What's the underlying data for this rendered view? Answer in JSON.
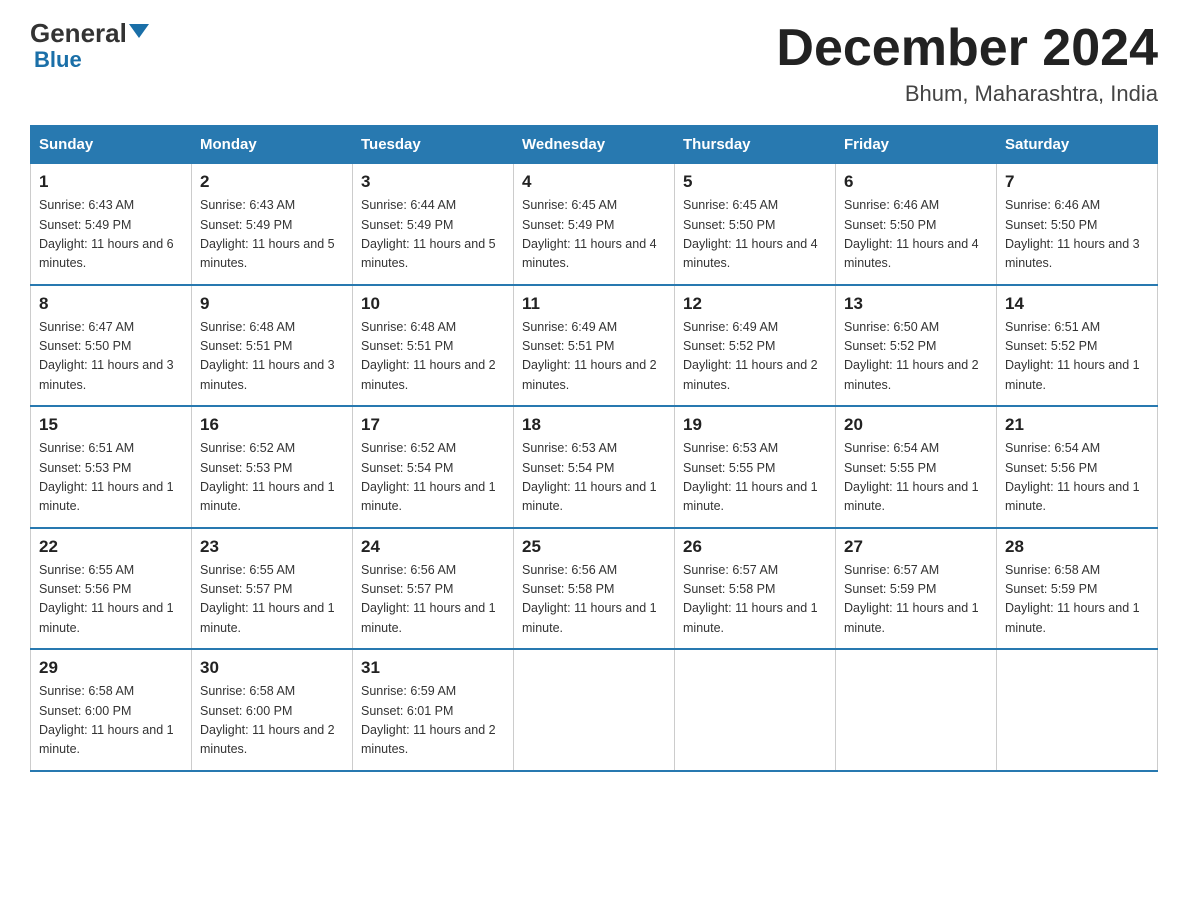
{
  "header": {
    "logo_general": "General",
    "logo_blue": "Blue",
    "month_title": "December 2024",
    "location": "Bhum, Maharashtra, India"
  },
  "weekdays": [
    "Sunday",
    "Monday",
    "Tuesday",
    "Wednesday",
    "Thursday",
    "Friday",
    "Saturday"
  ],
  "weeks": [
    [
      {
        "day": "1",
        "sunrise": "6:43 AM",
        "sunset": "5:49 PM",
        "daylight": "11 hours and 6 minutes."
      },
      {
        "day": "2",
        "sunrise": "6:43 AM",
        "sunset": "5:49 PM",
        "daylight": "11 hours and 5 minutes."
      },
      {
        "day": "3",
        "sunrise": "6:44 AM",
        "sunset": "5:49 PM",
        "daylight": "11 hours and 5 minutes."
      },
      {
        "day": "4",
        "sunrise": "6:45 AM",
        "sunset": "5:49 PM",
        "daylight": "11 hours and 4 minutes."
      },
      {
        "day": "5",
        "sunrise": "6:45 AM",
        "sunset": "5:50 PM",
        "daylight": "11 hours and 4 minutes."
      },
      {
        "day": "6",
        "sunrise": "6:46 AM",
        "sunset": "5:50 PM",
        "daylight": "11 hours and 4 minutes."
      },
      {
        "day": "7",
        "sunrise": "6:46 AM",
        "sunset": "5:50 PM",
        "daylight": "11 hours and 3 minutes."
      }
    ],
    [
      {
        "day": "8",
        "sunrise": "6:47 AM",
        "sunset": "5:50 PM",
        "daylight": "11 hours and 3 minutes."
      },
      {
        "day": "9",
        "sunrise": "6:48 AM",
        "sunset": "5:51 PM",
        "daylight": "11 hours and 3 minutes."
      },
      {
        "day": "10",
        "sunrise": "6:48 AM",
        "sunset": "5:51 PM",
        "daylight": "11 hours and 2 minutes."
      },
      {
        "day": "11",
        "sunrise": "6:49 AM",
        "sunset": "5:51 PM",
        "daylight": "11 hours and 2 minutes."
      },
      {
        "day": "12",
        "sunrise": "6:49 AM",
        "sunset": "5:52 PM",
        "daylight": "11 hours and 2 minutes."
      },
      {
        "day": "13",
        "sunrise": "6:50 AM",
        "sunset": "5:52 PM",
        "daylight": "11 hours and 2 minutes."
      },
      {
        "day": "14",
        "sunrise": "6:51 AM",
        "sunset": "5:52 PM",
        "daylight": "11 hours and 1 minute."
      }
    ],
    [
      {
        "day": "15",
        "sunrise": "6:51 AM",
        "sunset": "5:53 PM",
        "daylight": "11 hours and 1 minute."
      },
      {
        "day": "16",
        "sunrise": "6:52 AM",
        "sunset": "5:53 PM",
        "daylight": "11 hours and 1 minute."
      },
      {
        "day": "17",
        "sunrise": "6:52 AM",
        "sunset": "5:54 PM",
        "daylight": "11 hours and 1 minute."
      },
      {
        "day": "18",
        "sunrise": "6:53 AM",
        "sunset": "5:54 PM",
        "daylight": "11 hours and 1 minute."
      },
      {
        "day": "19",
        "sunrise": "6:53 AM",
        "sunset": "5:55 PM",
        "daylight": "11 hours and 1 minute."
      },
      {
        "day": "20",
        "sunrise": "6:54 AM",
        "sunset": "5:55 PM",
        "daylight": "11 hours and 1 minute."
      },
      {
        "day": "21",
        "sunrise": "6:54 AM",
        "sunset": "5:56 PM",
        "daylight": "11 hours and 1 minute."
      }
    ],
    [
      {
        "day": "22",
        "sunrise": "6:55 AM",
        "sunset": "5:56 PM",
        "daylight": "11 hours and 1 minute."
      },
      {
        "day": "23",
        "sunrise": "6:55 AM",
        "sunset": "5:57 PM",
        "daylight": "11 hours and 1 minute."
      },
      {
        "day": "24",
        "sunrise": "6:56 AM",
        "sunset": "5:57 PM",
        "daylight": "11 hours and 1 minute."
      },
      {
        "day": "25",
        "sunrise": "6:56 AM",
        "sunset": "5:58 PM",
        "daylight": "11 hours and 1 minute."
      },
      {
        "day": "26",
        "sunrise": "6:57 AM",
        "sunset": "5:58 PM",
        "daylight": "11 hours and 1 minute."
      },
      {
        "day": "27",
        "sunrise": "6:57 AM",
        "sunset": "5:59 PM",
        "daylight": "11 hours and 1 minute."
      },
      {
        "day": "28",
        "sunrise": "6:58 AM",
        "sunset": "5:59 PM",
        "daylight": "11 hours and 1 minute."
      }
    ],
    [
      {
        "day": "29",
        "sunrise": "6:58 AM",
        "sunset": "6:00 PM",
        "daylight": "11 hours and 1 minute."
      },
      {
        "day": "30",
        "sunrise": "6:58 AM",
        "sunset": "6:00 PM",
        "daylight": "11 hours and 2 minutes."
      },
      {
        "day": "31",
        "sunrise": "6:59 AM",
        "sunset": "6:01 PM",
        "daylight": "11 hours and 2 minutes."
      },
      null,
      null,
      null,
      null
    ]
  ]
}
